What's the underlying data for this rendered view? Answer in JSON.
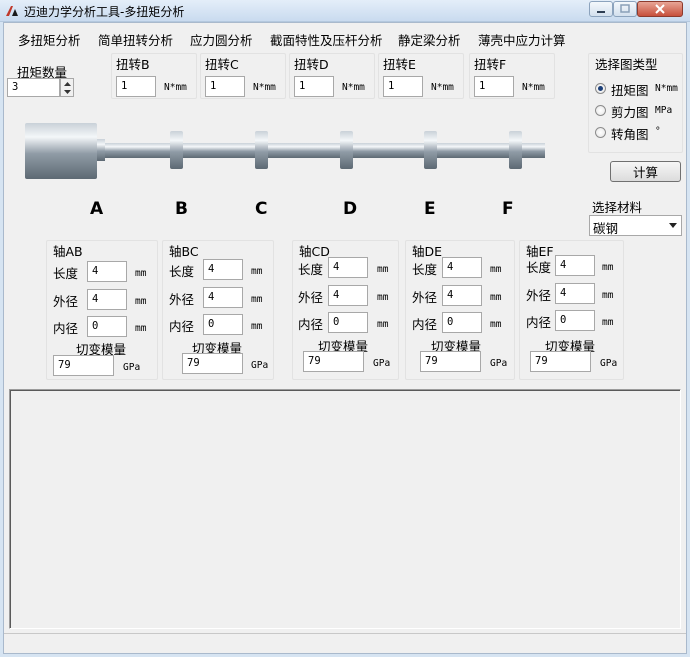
{
  "window": {
    "title": "迈迪力学分析工具-多扭矩分析"
  },
  "menu": [
    "多扭矩分析",
    "简单扭转分析",
    "应力圆分析",
    "截面特性及压杆分析",
    "静定梁分析",
    "薄壳中应力计算"
  ],
  "torque_count": {
    "label": "扭矩数量",
    "value": "3"
  },
  "torques": [
    {
      "label": "扭转B",
      "value": "1",
      "unit": "N*mm"
    },
    {
      "label": "扭转C",
      "value": "1",
      "unit": "N*mm"
    },
    {
      "label": "扭转D",
      "value": "1",
      "unit": "N*mm"
    },
    {
      "label": "扭转E",
      "value": "1",
      "unit": "N*mm"
    },
    {
      "label": "扭转F",
      "value": "1",
      "unit": "N*mm"
    }
  ],
  "chart_type": {
    "title": "选择图类型",
    "options": [
      {
        "label": "扭矩图",
        "unit": "N*mm",
        "checked": true
      },
      {
        "label": "剪力图",
        "unit": "MPa",
        "checked": false
      },
      {
        "label": "转角图",
        "unit": "°",
        "checked": false
      }
    ]
  },
  "calc_button": "计算",
  "material": {
    "label": "选择材料",
    "value": "碳钢"
  },
  "points": [
    "A",
    "B",
    "C",
    "D",
    "E",
    "F"
  ],
  "field_labels": {
    "length": "长度",
    "outer": "外径",
    "inner": "内径",
    "shear": "切变模量"
  },
  "units": {
    "length": "mm",
    "modulus": "GPa"
  },
  "shafts": [
    {
      "name": "轴AB",
      "length": "4",
      "outer": "4",
      "inner": "0",
      "modulus": "79"
    },
    {
      "name": "轴BC",
      "length": "4",
      "outer": "4",
      "inner": "0",
      "modulus": "79"
    },
    {
      "name": "轴CD",
      "length": "4",
      "outer": "4",
      "inner": "0",
      "modulus": "79"
    },
    {
      "name": "轴DE",
      "length": "4",
      "outer": "4",
      "inner": "0",
      "modulus": "79"
    },
    {
      "name": "轴EF",
      "length": "4",
      "outer": "4",
      "inner": "0",
      "modulus": "79"
    }
  ],
  "colors": {
    "title_gradient_top": "#e4eef9",
    "close_button": "#c7503c",
    "window_bg": "#f0f0f0",
    "radio_dot": "#1c3f78"
  }
}
